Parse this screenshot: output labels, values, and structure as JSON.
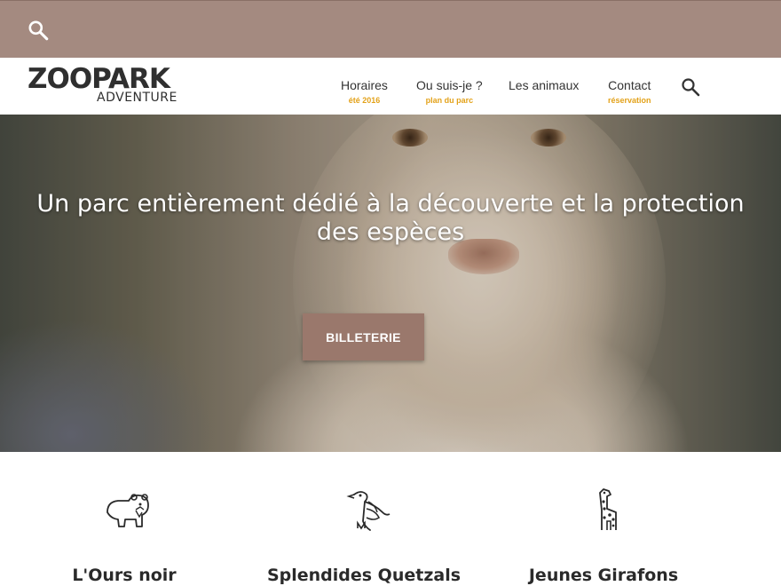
{
  "topbar": {
    "search_icon": "search-icon"
  },
  "brand": {
    "name": "ZOOPARK",
    "tagline": "ADVENTURE"
  },
  "nav": {
    "items": [
      {
        "label": "Horaires",
        "sub": "été 2016"
      },
      {
        "label": "Ou suis-je ?",
        "sub": "plan du parc"
      },
      {
        "label": "Les animaux",
        "sub": ""
      },
      {
        "label": "Contact",
        "sub": "réservation"
      }
    ],
    "search_icon": "search-icon"
  },
  "hero": {
    "title": "Un parc entièrement dédié à la découverte et la protection des espèces",
    "cta": "BILLETERIE"
  },
  "features": [
    {
      "icon": "bear-icon",
      "title": "L'Ours noir"
    },
    {
      "icon": "bird-icon",
      "title": "Splendides Quetzals"
    },
    {
      "icon": "giraffe-icon",
      "title": "Jeunes Girafons"
    }
  ],
  "colors": {
    "topbar": "#a48a80",
    "cta": "#9a786c",
    "accent": "#e3a21a",
    "text": "#333333"
  }
}
